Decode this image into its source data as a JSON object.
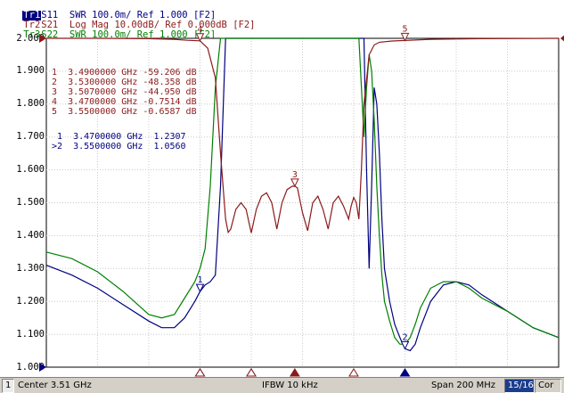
{
  "traces": [
    {
      "id": "Tr1",
      "text": "S11  SWR 100.0m/ Ref 1.000 [F2]",
      "color": "#000080"
    },
    {
      "id": "Tr2",
      "text": "S21  Log Mag 10.00dB/ Ref 0.000dB [F2]",
      "color": "#8b1a1a"
    },
    {
      "id": "Tr3",
      "text": "S22  SWR 100.0m/ Ref 1.000 [F2]",
      "color": "#008000"
    }
  ],
  "y_axis_labels": [
    "2.000",
    "1.900",
    "1.800",
    "1.700",
    "1.600",
    "1.500",
    "1.400",
    "1.300",
    "1.200",
    "1.100",
    "1.000"
  ],
  "marker_table_s21": [
    {
      "n": "1",
      "freq": "3.4900000 GHz",
      "value": "-59.206 dB"
    },
    {
      "n": "2",
      "freq": "3.5300000 GHz",
      "value": "-48.358 dB"
    },
    {
      "n": "3",
      "freq": "3.5070000 GHz",
      "value": "-44.950 dB"
    },
    {
      "n": "4",
      "freq": "3.4700000 GHz",
      "value": "-0.7514 dB"
    },
    {
      "n": "5",
      "freq": "3.5500000 GHz",
      "value": "-0.6587 dB"
    }
  ],
  "marker_table_s11": [
    {
      "n": "1",
      "prefix": " ",
      "freq": "3.4700000 GHz",
      "value": "1.2307"
    },
    {
      "n": "2",
      "prefix": ">",
      "freq": "3.5500000 GHz",
      "value": "1.0560"
    }
  ],
  "marker_flags": [
    "4",
    "3",
    "5",
    "1",
    "2"
  ],
  "status": {
    "channel": "1",
    "center": "Center 3.51 GHz",
    "ifbw": "IFBW 10 kHz",
    "span": "Span 200 MHz",
    "trace_count": "15/16",
    "cor": "Cor"
  },
  "chart_data": {
    "type": "line",
    "x_axis": {
      "center_ghz": 3.51,
      "span_mhz": 200,
      "start_ghz": 3.41,
      "stop_ghz": 3.61
    },
    "y_axis": {
      "ticks": [
        1.0,
        1.1,
        1.2,
        1.3,
        1.4,
        1.5,
        1.6,
        1.7,
        1.8,
        1.9,
        2.0
      ],
      "ylim": [
        1.0,
        2.0
      ]
    },
    "grid": true,
    "series": [
      {
        "name": "S11 SWR",
        "color": "#000080",
        "x": [
          3.41,
          3.42,
          3.43,
          3.44,
          3.45,
          3.455,
          3.46,
          3.464,
          3.468,
          3.47,
          3.472,
          3.474,
          3.476,
          3.478,
          3.48,
          3.482,
          3.484,
          3.486,
          3.488,
          3.49,
          3.495,
          3.5,
          3.505,
          3.51,
          3.515,
          3.52,
          3.525,
          3.53,
          3.532,
          3.534,
          3.535,
          3.536,
          3.537,
          3.538,
          3.539,
          3.54,
          3.541,
          3.542,
          3.544,
          3.546,
          3.548,
          3.55,
          3.552,
          3.554,
          3.556,
          3.56,
          3.565,
          3.57,
          3.575,
          3.58,
          3.59,
          3.6,
          3.61
        ],
        "y": [
          1.31,
          1.28,
          1.24,
          1.19,
          1.14,
          1.12,
          1.12,
          1.15,
          1.2,
          1.23,
          1.25,
          1.26,
          1.28,
          1.55,
          2.0,
          2.0,
          2.0,
          2.0,
          2.0,
          2.0,
          2.0,
          2.0,
          2.0,
          2.0,
          2.0,
          2.0,
          2.0,
          2.0,
          2.0,
          2.0,
          1.6,
          1.3,
          1.55,
          1.85,
          1.8,
          1.65,
          1.45,
          1.3,
          1.2,
          1.13,
          1.09,
          1.056,
          1.05,
          1.07,
          1.12,
          1.2,
          1.25,
          1.26,
          1.25,
          1.22,
          1.17,
          1.12,
          1.09
        ]
      },
      {
        "name": "S22 SWR",
        "color": "#008000",
        "x": [
          3.41,
          3.42,
          3.43,
          3.44,
          3.45,
          3.455,
          3.46,
          3.464,
          3.468,
          3.47,
          3.472,
          3.474,
          3.476,
          3.478,
          3.48,
          3.482,
          3.484,
          3.486,
          3.488,
          3.49,
          3.495,
          3.5,
          3.505,
          3.51,
          3.515,
          3.52,
          3.525,
          3.53,
          3.532,
          3.534,
          3.535,
          3.536,
          3.537,
          3.538,
          3.539,
          3.54,
          3.541,
          3.542,
          3.544,
          3.546,
          3.548,
          3.55,
          3.552,
          3.554,
          3.556,
          3.56,
          3.565,
          3.57,
          3.575,
          3.58,
          3.59,
          3.6,
          3.61
        ],
        "y": [
          1.35,
          1.33,
          1.29,
          1.23,
          1.16,
          1.15,
          1.16,
          1.21,
          1.26,
          1.3,
          1.36,
          1.55,
          1.85,
          2.0,
          2.0,
          2.0,
          2.0,
          2.0,
          2.0,
          2.0,
          2.0,
          2.0,
          2.0,
          2.0,
          2.0,
          2.0,
          2.0,
          2.0,
          2.0,
          1.7,
          1.85,
          1.95,
          1.9,
          1.75,
          1.55,
          1.4,
          1.28,
          1.2,
          1.14,
          1.09,
          1.07,
          1.07,
          1.09,
          1.13,
          1.18,
          1.24,
          1.26,
          1.26,
          1.24,
          1.21,
          1.17,
          1.12,
          1.09
        ]
      },
      {
        "name": "S21 Log Mag",
        "color": "#8b1a1a",
        "x": [
          3.41,
          3.43,
          3.45,
          3.46,
          3.465,
          3.47,
          3.473,
          3.476,
          3.478,
          3.48,
          3.481,
          3.482,
          3.484,
          3.486,
          3.488,
          3.49,
          3.492,
          3.494,
          3.496,
          3.498,
          3.5,
          3.502,
          3.504,
          3.506,
          3.507,
          3.508,
          3.51,
          3.512,
          3.514,
          3.516,
          3.518,
          3.52,
          3.522,
          3.524,
          3.526,
          3.528,
          3.529,
          3.53,
          3.531,
          3.532,
          3.533,
          3.534,
          3.536,
          3.538,
          3.54,
          3.545,
          3.55,
          3.56,
          3.58,
          3.61
        ],
        "y": [
          0,
          0,
          -0.1,
          -0.3,
          -0.6,
          -0.75,
          -3.0,
          -12,
          -35,
          -55,
          -59,
          -58,
          -52,
          -50,
          -52,
          -59.2,
          -52,
          -48,
          -47,
          -50,
          -58,
          -50,
          -46,
          -45,
          -44.95,
          -45.5,
          -53,
          -58.5,
          -50,
          -48,
          -52,
          -58,
          -50,
          -48,
          -51,
          -55,
          -51,
          -48.4,
          -50,
          -55,
          -40,
          -20,
          -5,
          -2,
          -1.2,
          -0.8,
          -0.66,
          -0.3,
          -0.1,
          0
        ]
      }
    ]
  }
}
